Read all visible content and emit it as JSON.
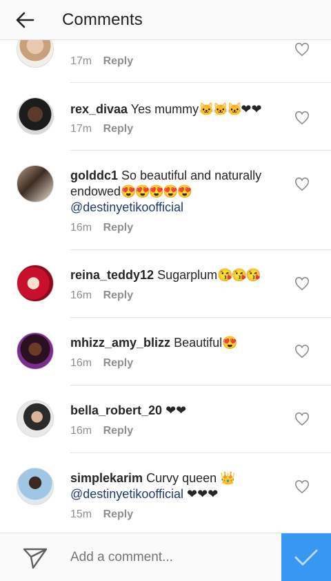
{
  "header": {
    "title": "Comments"
  },
  "comments": [
    {
      "user": "",
      "text": "",
      "mention": "",
      "trailing": "",
      "time": "17m",
      "reply": "Reply"
    },
    {
      "user": "rex_divaa",
      "text": "Yes mummy",
      "emoji": "🐱🐱🐱",
      "trailing": "❤❤",
      "time": "17m",
      "reply": "Reply"
    },
    {
      "user": "golddc1",
      "text": "So beautiful and naturally endowed",
      "emoji": "😍😍😍😍😍",
      "mention": "@destinyetikoofficial",
      "time": "16m",
      "reply": "Reply"
    },
    {
      "user": "reina_teddy12",
      "text": "Sugarplum",
      "emoji": "😘😘😘",
      "time": "16m",
      "reply": "Reply"
    },
    {
      "user": "mhizz_amy_blizz",
      "text": "Beautiful",
      "emoji": "😍",
      "time": "16m",
      "reply": "Reply"
    },
    {
      "user": "bella_robert_20",
      "text": "❤❤",
      "time": "16m",
      "reply": "Reply"
    },
    {
      "user": "simplekarim",
      "text": "Curvy queen",
      "emoji": "👑",
      "mention": "@destinyetikoofficial",
      "trailing": "❤❤❤",
      "time": "15m",
      "reply": "Reply"
    }
  ],
  "composer": {
    "placeholder": "Add a comment..."
  },
  "colors": {
    "accent": "#3897f0",
    "mention": "#1f3b6e",
    "muted": "#8e8e8e"
  }
}
